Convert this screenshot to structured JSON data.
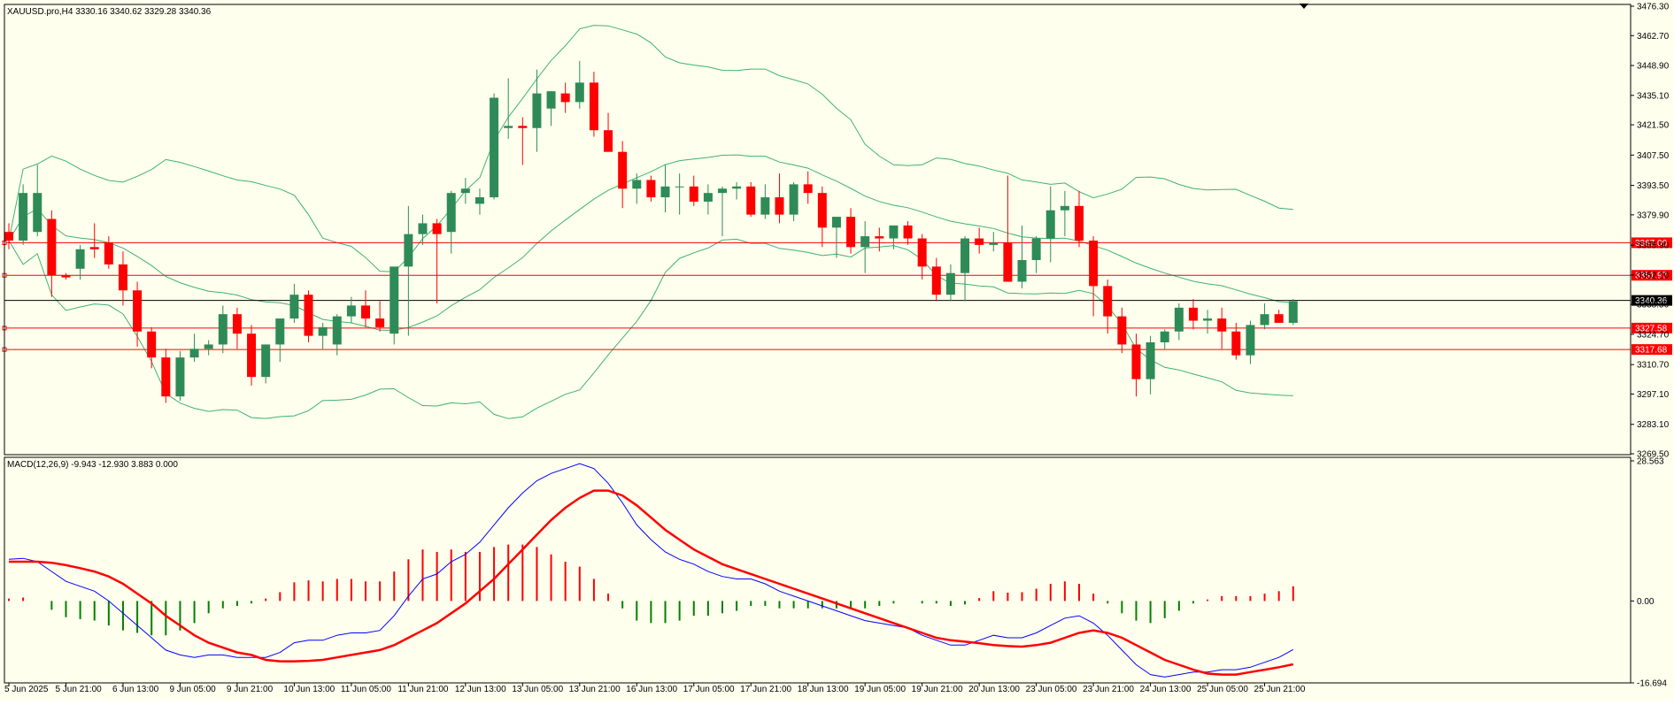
{
  "main_header": "XAUUSD.pro,H4  3330.16 3340.62 3329.28 3340.36",
  "macd_header": "MACD(12,26,9) -9.943 -12.930 3.883 0.000",
  "colors": {
    "background": "#ffffee",
    "bull": "#2e8b57",
    "bear": "#ff0000",
    "wick_bull": "#2e8b57",
    "wick_bear": "#ff0000",
    "bands": "#3cb371",
    "hline": "#ff0000",
    "price_line": "#000000",
    "macd_line": "#0000ff",
    "signal_line": "#ff0000",
    "hist_pos": "#ff0000",
    "hist_neg": "#008000"
  },
  "chart_data": [
    {
      "type": "candlestick",
      "title": "XAUUSD.pro,H4",
      "timeframe": "H4",
      "ylim": [
        3269.5,
        3476.3
      ],
      "y_ticks": [
        "3476.30",
        "3462.70",
        "3448.90",
        "3435.10",
        "3421.50",
        "3407.50",
        "3393.50",
        "3379.90",
        "3365.90",
        "3352.10",
        "3338.50",
        "3324.70",
        "3310.70",
        "3297.10",
        "3283.10",
        "3269.50"
      ],
      "x_labels": [
        "5 Jun 2025",
        "5 Jun 21:00",
        "6 Jun 13:00",
        "9 Jun 05:00",
        "9 Jun 21:00",
        "10 Jun 13:00",
        "11 Jun 05:00",
        "11 Jun 21:00",
        "12 Jun 13:00",
        "13 Jun 05:00",
        "13 Jun 21:00",
        "16 Jun 13:00",
        "17 Jun 05:00",
        "17 Jun 21:00",
        "18 Jun 13:00",
        "19 Jun 05:00",
        "19 Jun 21:00",
        "20 Jun 13:00",
        "23 Jun 05:00",
        "23 Jun 21:00",
        "24 Jun 13:00",
        "25 Jun 05:00",
        "25 Jun 21:00"
      ],
      "current_price": "3340.36",
      "horizontal_levels": [
        "3367.00",
        "3351.97",
        "3327.58",
        "3317.68"
      ],
      "candles_ohlc": [
        [
          3372,
          3376,
          3364,
          3368
        ],
        [
          3368,
          3394,
          3366,
          3390
        ],
        [
          3372,
          3403,
          3370,
          3390
        ],
        [
          3378,
          3382,
          3342,
          3352
        ],
        [
          3352,
          3353,
          3350,
          3351
        ],
        [
          3355,
          3366,
          3350,
          3364
        ],
        [
          3365,
          3376,
          3360,
          3364
        ],
        [
          3367,
          3370,
          3355,
          3357
        ],
        [
          3357,
          3363,
          3338,
          3345
        ],
        [
          3345,
          3349,
          3319,
          3326
        ],
        [
          3326,
          3328,
          3309,
          3314
        ],
        [
          3314,
          3318,
          3293,
          3296
        ],
        [
          3296,
          3317,
          3294,
          3314
        ],
        [
          3314,
          3325,
          3312,
          3318
        ],
        [
          3318,
          3322,
          3315,
          3320
        ],
        [
          3320,
          3338,
          3316,
          3334
        ],
        [
          3334,
          3337,
          3318,
          3325
        ],
        [
          3325,
          3329,
          3301,
          3305
        ],
        [
          3305,
          3320,
          3302,
          3320
        ],
        [
          3320,
          3332,
          3312,
          3332
        ],
        [
          3332,
          3348,
          3330,
          3343
        ],
        [
          3343,
          3345,
          3321,
          3324
        ],
        [
          3324,
          3330,
          3318,
          3328
        ],
        [
          3320,
          3334,
          3315,
          3333
        ],
        [
          3333,
          3342,
          3330,
          3338
        ],
        [
          3338,
          3345,
          3328,
          3332
        ],
        [
          3332,
          3340,
          3326,
          3328
        ],
        [
          3325,
          3350,
          3320,
          3356
        ],
        [
          3356,
          3384,
          3324,
          3371
        ],
        [
          3371,
          3380,
          3366,
          3376
        ],
        [
          3376,
          3378,
          3339,
          3371
        ],
        [
          3372,
          3391,
          3362,
          3390
        ],
        [
          3390,
          3397,
          3385,
          3392
        ],
        [
          3385,
          3392,
          3380,
          3388
        ],
        [
          3388,
          3436,
          3387,
          3434
        ],
        [
          3420,
          3443,
          3415,
          3421
        ],
        [
          3421,
          3425,
          3403,
          3420
        ],
        [
          3420,
          3447,
          3409,
          3436
        ],
        [
          3429,
          3437,
          3421,
          3437
        ],
        [
          3436,
          3441,
          3427,
          3432
        ],
        [
          3432,
          3451,
          3429,
          3441
        ],
        [
          3441,
          3446,
          3416,
          3419
        ],
        [
          3419,
          3427,
          3409,
          3409
        ],
        [
          3409,
          3414,
          3383,
          3392
        ],
        [
          3392,
          3399,
          3385,
          3396
        ],
        [
          3396,
          3398,
          3386,
          3388
        ],
        [
          3388,
          3403,
          3381,
          3393
        ],
        [
          3393,
          3399,
          3380,
          3393
        ],
        [
          3393,
          3398,
          3384,
          3386
        ],
        [
          3386,
          3394,
          3380,
          3390
        ],
        [
          3390,
          3393,
          3370,
          3392
        ],
        [
          3392,
          3395,
          3387,
          3393
        ],
        [
          3393,
          3395,
          3379,
          3380
        ],
        [
          3380,
          3394,
          3378,
          3388
        ],
        [
          3388,
          3399,
          3376,
          3380
        ],
        [
          3380,
          3395,
          3377,
          3394
        ],
        [
          3394,
          3400,
          3385,
          3390
        ],
        [
          3390,
          3393,
          3365,
          3374
        ],
        [
          3374,
          3378,
          3360,
          3379
        ],
        [
          3379,
          3383,
          3362,
          3365
        ],
        [
          3365,
          3377,
          3353,
          3370
        ],
        [
          3370,
          3374,
          3363,
          3369
        ],
        [
          3369,
          3374,
          3364,
          3375
        ],
        [
          3375,
          3377,
          3366,
          3369
        ],
        [
          3369,
          3371,
          3350,
          3356
        ],
        [
          3356,
          3360,
          3340,
          3343
        ],
        [
          3343,
          3357,
          3340,
          3353
        ],
        [
          3353,
          3370,
          3340,
          3369
        ],
        [
          3369,
          3374,
          3362,
          3366
        ],
        [
          3366,
          3372,
          3363,
          3367
        ],
        [
          3367,
          3398,
          3351,
          3349
        ],
        [
          3349,
          3375,
          3346,
          3359
        ],
        [
          3359,
          3370,
          3353,
          3369
        ],
        [
          3369,
          3393,
          3358,
          3382
        ],
        [
          3382,
          3391,
          3370,
          3384
        ],
        [
          3384,
          3391,
          3365,
          3368
        ],
        [
          3368,
          3370,
          3333,
          3347
        ],
        [
          3347,
          3350,
          3325,
          3333
        ],
        [
          3333,
          3337,
          3316,
          3320
        ],
        [
          3320,
          3325,
          3296,
          3304
        ],
        [
          3304,
          3324,
          3297,
          3321
        ],
        [
          3321,
          3327,
          3318,
          3326
        ],
        [
          3326,
          3339,
          3322,
          3337
        ],
        [
          3337,
          3341,
          3327,
          3331
        ],
        [
          3331,
          3336,
          3325,
          3332
        ],
        [
          3332,
          3337,
          3318,
          3326
        ],
        [
          3326,
          3330,
          3313,
          3315
        ],
        [
          3315,
          3331,
          3311,
          3329
        ],
        [
          3329,
          3339,
          3327,
          3334
        ],
        [
          3334,
          3336,
          3330,
          3330
        ],
        [
          3330,
          3341,
          3329,
          3340
        ]
      ]
    },
    {
      "type": "line",
      "title": "MACD(12,26,9)",
      "values_header": [
        "-9.943",
        "-12.930",
        "3.883",
        "0.000"
      ],
      "ylim": [
        -16.694,
        28.563
      ],
      "y_ticks": [
        "28.563",
        "0.00",
        "-16.694"
      ],
      "series": [
        {
          "name": "MACD",
          "values": [
            8.5,
            8.7,
            8.0,
            6.0,
            4.0,
            3.0,
            2.0,
            0.0,
            -2.5,
            -5.0,
            -7.5,
            -10.0,
            -11.0,
            -11.5,
            -11.0,
            -11.0,
            -11.5,
            -11.5,
            -11.5,
            -10.5,
            -8.5,
            -8.0,
            -8.0,
            -7.0,
            -6.5,
            -6.5,
            -6.0,
            -3.0,
            1.0,
            4.5,
            5.5,
            8.0,
            9.5,
            12.0,
            15.5,
            19.0,
            22.0,
            24.5,
            26.0,
            27.0,
            28.0,
            27.0,
            24.0,
            20.0,
            15.5,
            12.5,
            10.0,
            8.5,
            7.5,
            6.0,
            5.0,
            4.5,
            4.5,
            3.5,
            2.0,
            1.0,
            0.0,
            -1.0,
            -2.0,
            -3.0,
            -4.0,
            -4.5,
            -5.0,
            -5.5,
            -7.0,
            -8.0,
            -9.0,
            -9.0,
            -8.0,
            -7.0,
            -7.5,
            -7.5,
            -6.5,
            -5.0,
            -3.5,
            -3.0,
            -4.5,
            -7.0,
            -10.0,
            -13.0,
            -15.0,
            -15.5,
            -15.0,
            -14.5,
            -14.5,
            -14.0,
            -14.0,
            -13.5,
            -12.5,
            -11.5,
            -9.9
          ]
        },
        {
          "name": "Signal",
          "values": [
            8.0,
            8.0,
            8.0,
            7.8,
            7.3,
            6.7,
            6.0,
            5.0,
            3.5,
            1.5,
            -0.5,
            -3.0,
            -5.0,
            -7.0,
            -8.5,
            -9.5,
            -10.5,
            -11.0,
            -12.0,
            -12.3,
            -12.3,
            -12.2,
            -12.0,
            -11.5,
            -11.0,
            -10.5,
            -10.0,
            -9.0,
            -7.5,
            -6.0,
            -4.5,
            -2.5,
            -0.5,
            2.0,
            4.5,
            7.5,
            10.5,
            13.5,
            16.5,
            19.0,
            21.0,
            22.5,
            22.5,
            21.5,
            19.5,
            17.0,
            14.5,
            12.5,
            10.5,
            9.0,
            7.5,
            6.5,
            5.5,
            4.5,
            3.5,
            2.5,
            1.5,
            0.5,
            -0.5,
            -1.5,
            -2.5,
            -3.5,
            -4.5,
            -5.5,
            -6.5,
            -7.5,
            -8.0,
            -8.3,
            -8.6,
            -9.0,
            -9.2,
            -9.3,
            -9.0,
            -8.5,
            -7.5,
            -6.5,
            -6.0,
            -6.5,
            -7.5,
            -9.0,
            -10.5,
            -12.0,
            -13.0,
            -14.0,
            -14.8,
            -15.0,
            -15.0,
            -14.5,
            -14.0,
            -13.5,
            -12.9
          ]
        },
        {
          "name": "Histogram",
          "values": [
            0.5,
            0.7,
            0.0,
            -1.8,
            -3.3,
            -3.7,
            -4.0,
            -5.0,
            -6.0,
            -6.5,
            -7.0,
            -7.0,
            -6.0,
            -4.5,
            -2.5,
            -1.5,
            -1.0,
            -0.5,
            0.5,
            1.8,
            3.8,
            4.2,
            4.0,
            4.5,
            4.5,
            4.0,
            4.0,
            6.0,
            8.5,
            10.5,
            10.0,
            10.5,
            10.0,
            10.0,
            11.0,
            11.5,
            11.5,
            11.0,
            9.5,
            8.0,
            7.0,
            4.5,
            1.5,
            -1.5,
            -4.0,
            -4.5,
            -4.5,
            -4.0,
            -3.0,
            -3.0,
            -2.5,
            -2.0,
            -1.0,
            -1.0,
            -1.5,
            -1.5,
            -1.5,
            -1.5,
            -1.5,
            -1.5,
            -1.5,
            -1.0,
            -0.5,
            0.0,
            -0.5,
            -0.5,
            -1.0,
            -0.7,
            0.6,
            2.0,
            1.7,
            1.8,
            2.5,
            3.5,
            4.0,
            3.5,
            1.5,
            -0.5,
            -2.5,
            -4.0,
            -4.5,
            -3.5,
            -2.0,
            -0.5,
            0.3,
            1.0,
            1.0,
            1.0,
            1.5,
            2.0,
            3.0
          ]
        }
      ]
    }
  ]
}
